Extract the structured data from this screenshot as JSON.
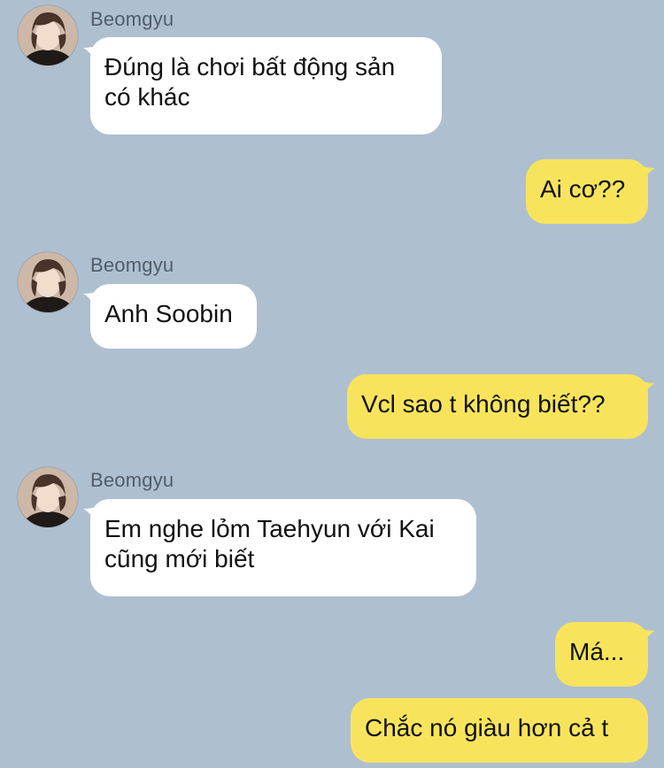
{
  "messages": [
    {
      "sender": "Beomgyu",
      "text_lines": [
        "Đúng là chơi bất động sản",
        "có khác"
      ]
    },
    {
      "text": "Ai cơ??"
    },
    {
      "sender": "Beomgyu",
      "text": "Anh Soobin"
    },
    {
      "text": "Vcl sao t không biết??"
    },
    {
      "sender": "Beomgyu",
      "text_lines": [
        "Em nghe lỏm Taehyun với Kai",
        "cũng mới biết"
      ]
    },
    {
      "text": "Má..."
    },
    {
      "text": "Chắc nó giàu hơn cả t"
    }
  ],
  "colors": {
    "background": "#aebfd0",
    "incoming_bubble": "#ffffff",
    "outgoing_bubble": "#f8e45c"
  },
  "icons": [
    "avatar-photo"
  ]
}
